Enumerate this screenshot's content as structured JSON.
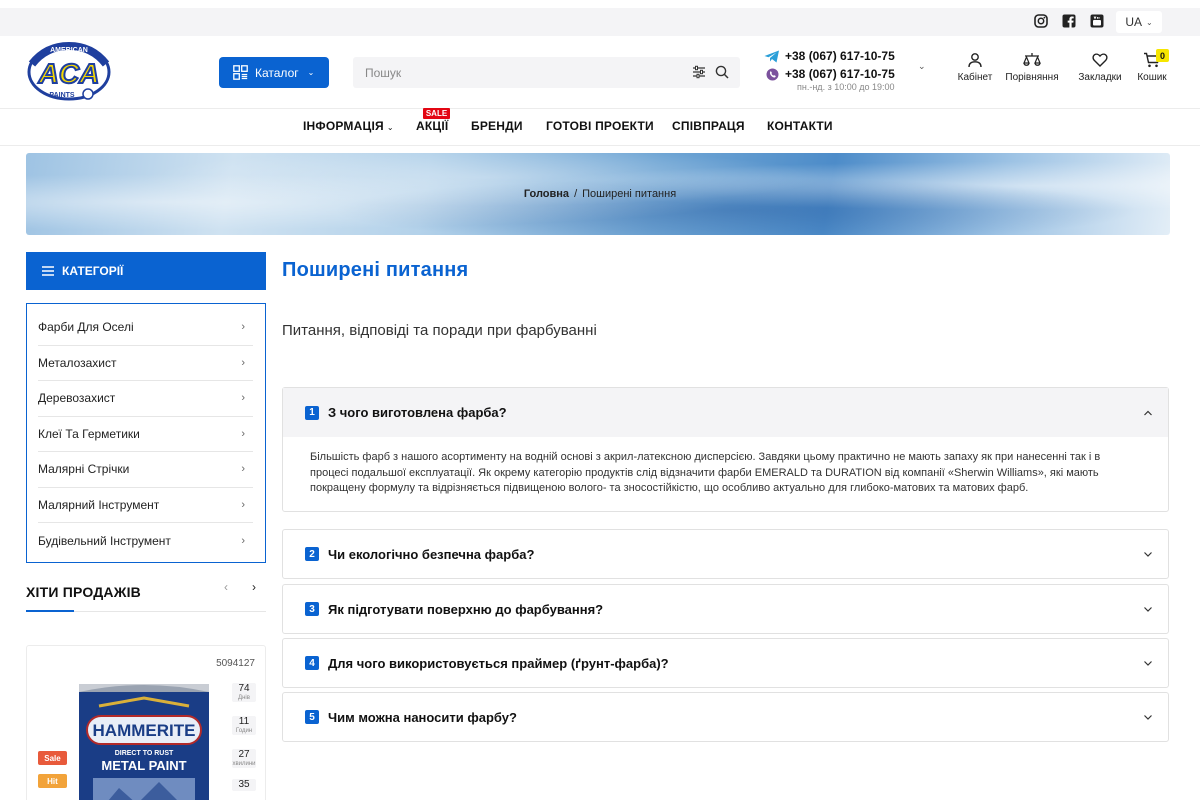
{
  "topbar": {
    "socials": [
      "instagram-icon",
      "facebook-icon",
      "youtube-icon"
    ],
    "language": "UA"
  },
  "header": {
    "logo_text": [
      "AMERICAN",
      "ACA",
      "PAINTS"
    ],
    "catalog_label": "Каталог",
    "search_placeholder": "Пошук",
    "phones": [
      "+38 (067) 617-10-75",
      "+38 (067) 617-10-75"
    ],
    "hours": "пн.-нд. з 10:00 до 19:00",
    "icons": {
      "cabinet": "Кабінет",
      "compare": "Порівняння",
      "bookmarks": "Закладки",
      "cart": "Кошик",
      "cart_count": "0"
    }
  },
  "nav": {
    "items": [
      "ІНФОРМАЦІЯ",
      "АКЦІЇ",
      "БРЕНДИ",
      "ГОТОВІ ПРОЕКТИ",
      "СПІВПРАЦЯ",
      "КОНТАКТИ"
    ],
    "sale_badge": "SALE"
  },
  "breadcrumb": {
    "home": "Головна",
    "separator": "/",
    "current": "Поширені питання"
  },
  "sidebar": {
    "categories_title": "КАТЕГОРІЇ",
    "categories": [
      "Фарби Для Оселі",
      "Металозахист",
      "Деревозахист",
      "Клеї Та Герметики",
      "Малярні Стрічки",
      "Малярний Інструмент",
      "Будівельний Інструмент"
    ],
    "hits_title": "ХІТИ ПРОДАЖІВ",
    "product": {
      "sku": "5094127",
      "timer": [
        {
          "value": "74",
          "unit": "Днів"
        },
        {
          "value": "11",
          "unit": "Годин"
        },
        {
          "value": "27",
          "unit": "хвилини"
        },
        {
          "value": "35",
          "unit": ""
        }
      ],
      "badges": [
        "Sale",
        "Hit"
      ],
      "can_text": [
        "HAMMERITE",
        "DIRECT TO RUST",
        "METAL PAINT"
      ]
    }
  },
  "main": {
    "title": "Поширені питання",
    "subtitle": "Питання, відповіді та поради при фарбуванні",
    "faq": [
      {
        "num": "1",
        "question": "З чого виготовлена фарба?",
        "open": true,
        "answer": "Більшість фарб з нашого асортименту на водній основі з акрил-латексною дисперсією. Завдяки цьому практично не мають запаху як при нанесенні так і в процесі подальшої експлуатації. Як окрему категорію продуктів слід відзначити фарби EMERALD та DURATION від компанії «Sherwin Williams», які мають покращену формулу та відрізняється підвищеною волого- та зносостійкістю, що особливо актуально для глибоко-матових та матових фарб."
      },
      {
        "num": "2",
        "question": "Чи екологічно безпечна фарба?",
        "open": false
      },
      {
        "num": "3",
        "question": "Як підготувати поверхню до фарбування?",
        "open": false
      },
      {
        "num": "4",
        "question": "Для чого використовується праймер (ґрунт-фарба)?",
        "open": false
      },
      {
        "num": "5",
        "question": "Чим можна наносити фарбу?",
        "open": false
      }
    ]
  },
  "colors": {
    "accent": "#0a63d1",
    "sale": "#e30613",
    "cart_badge": "#f6e600",
    "badge_sale": "#e85a3b",
    "badge_hit": "#f2a33a"
  }
}
